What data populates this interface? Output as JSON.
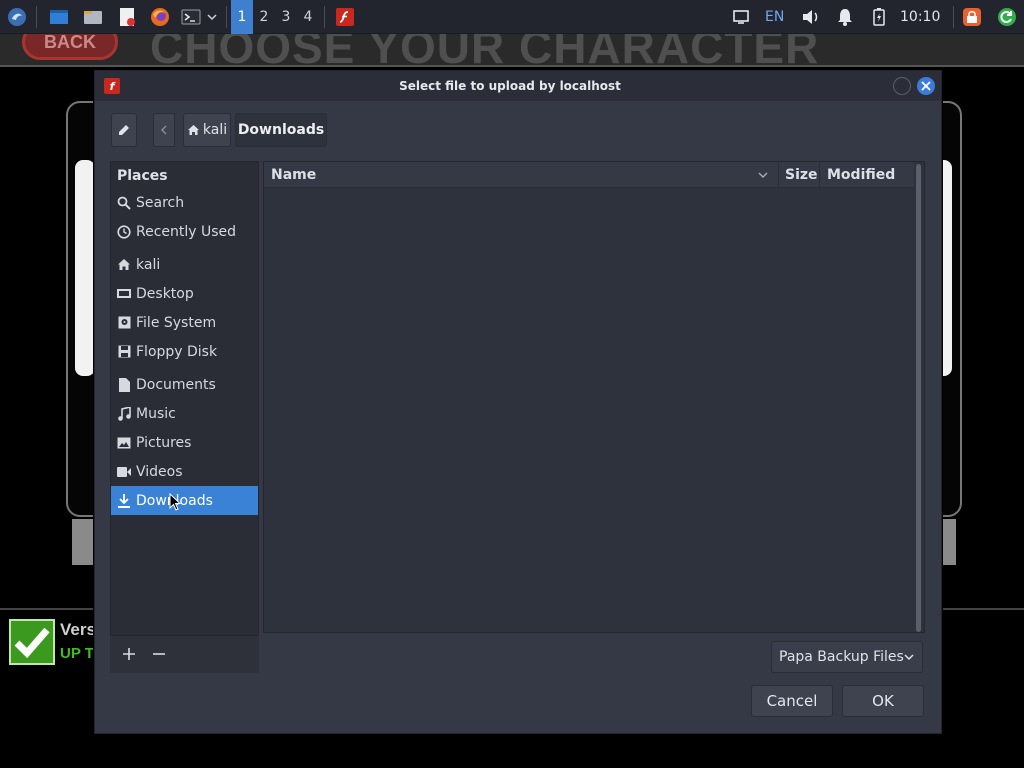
{
  "taskbar": {
    "workspaces": [
      "1",
      "2",
      "3",
      "4"
    ],
    "active_workspace": "1",
    "keyboard_layout": "EN",
    "clock": "10:10",
    "icons": [
      "kali-menu-icon",
      "desktop-icon",
      "file-manager-icon",
      "text-editor-icon",
      "firefox-icon",
      "terminal-icon",
      "flash-player-icon",
      "display-icon",
      "volume-icon",
      "notification-bell-icon",
      "battery-icon",
      "lock-icon",
      "update-icon"
    ]
  },
  "background_page": {
    "title": "CHOOSE YOUR CHARACTER",
    "back_button": "BACK",
    "version_label": "Vers",
    "status_label": "UP T"
  },
  "dialog": {
    "title": "Select file to upload by localhost",
    "breadcrumbs": [
      "kali",
      "Downloads"
    ],
    "sidebar": {
      "header": "Places",
      "items": [
        {
          "label": "Search",
          "icon": "search-icon"
        },
        {
          "label": "Recently Used",
          "icon": "clock-icon"
        },
        {
          "label": "kali",
          "icon": "home-icon"
        },
        {
          "label": "Desktop",
          "icon": "desktop-icon"
        },
        {
          "label": "File System",
          "icon": "drive-icon"
        },
        {
          "label": "Floppy Disk",
          "icon": "floppy-icon"
        },
        {
          "label": "Documents",
          "icon": "document-icon"
        },
        {
          "label": "Music",
          "icon": "music-icon"
        },
        {
          "label": "Pictures",
          "icon": "picture-icon"
        },
        {
          "label": "Videos",
          "icon": "video-icon"
        },
        {
          "label": "Downloads",
          "icon": "download-icon"
        }
      ],
      "selected": "Downloads"
    },
    "columns": [
      "Name",
      "Size",
      "Modified"
    ],
    "files": [],
    "filter": "Papa Backup Files",
    "cancel_label": "Cancel",
    "ok_label": "OK"
  },
  "colors": {
    "dialog_bg": "#353945",
    "accent": "#3a82d6",
    "taskbar_bg": "#23252e"
  }
}
